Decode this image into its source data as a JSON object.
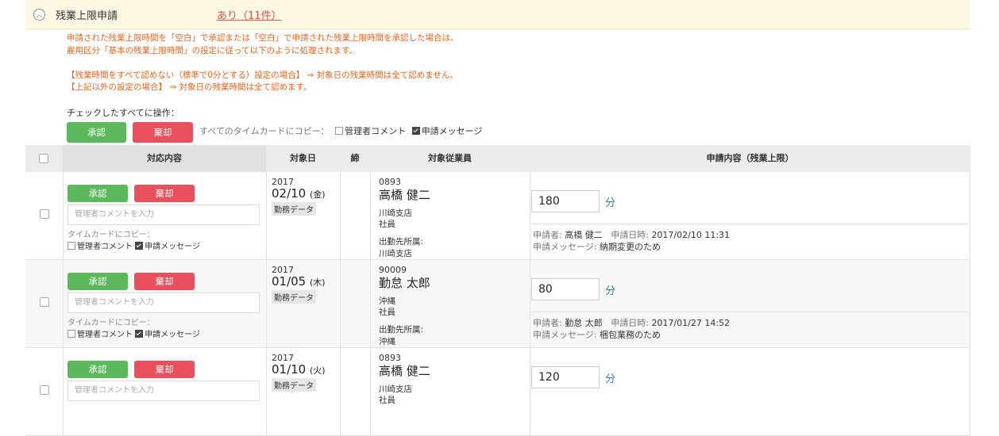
{
  "section": {
    "collapse_icon": "chevron-up-icon",
    "title": "残業上限申請",
    "count_link": "あり（11件）"
  },
  "notice": {
    "line1": "申請された残業上限時間を「空白」で承認または「空白」で申請された残業上限時間を承認した場合は、",
    "line2": "雇用区分「基本の残業上限時間」の設定に従って以下のように処理されます。",
    "line3": "【残業時間をすべて認めない（標準で0分とする）設定の場合】 ⇒ 対象日の残業時間は全て認めません。",
    "line4": "【上記以外の設定の場合】 ⇒ 対象日の残業時間は全て認めます。"
  },
  "bulk": {
    "label": "チェックしたすべてに操作：",
    "approve": "承認",
    "reject": "棄却",
    "copy_label": "すべてのタイムカードにコピー：",
    "admin_comment": "管理者コメント",
    "admin_comment_checked": false,
    "request_message": "申請メッセージ",
    "request_message_checked": true
  },
  "table": {
    "headers": {
      "action": "対応内容",
      "date": "対象日",
      "closed": "締",
      "employee": "対象従業員",
      "request": "申請内容（残業上限）"
    },
    "approve_label": "承認",
    "reject_label": "棄却",
    "comment_placeholder": "管理者コメントを入力",
    "copy_label": "タイムカードにコピー：",
    "admin_comment": "管理者コメント",
    "request_message": "申請メッセージ",
    "dispatch_label": "出勤先所属:",
    "unit": "分",
    "requester_label": "申請者:",
    "requested_at_label": "申請日時:",
    "message_label": "申請メッセージ:",
    "rows": [
      {
        "year": "2017",
        "date": "02/10",
        "weekday": "(金)",
        "badge": "勤務データ",
        "emp_id": "0893",
        "emp_name": "高橋 健二",
        "branch": "川崎支店",
        "role": "社員",
        "dispatch": "川崎支店",
        "minutes": "180",
        "requester": "高橋 健二",
        "requested_at": "2017/02/10 11:31",
        "message": "納期変更のため"
      },
      {
        "year": "2017",
        "date": "01/05",
        "weekday": "(木)",
        "badge": "勤務データ",
        "emp_id": "90009",
        "emp_name": "勤怠 太郎",
        "branch": "沖縄",
        "role": "社員",
        "dispatch": "沖縄",
        "minutes": "80",
        "requester": "勤怠 太郎",
        "requested_at": "2017/01/27 14:52",
        "message": "梱包業務のため"
      },
      {
        "year": "2017",
        "date": "01/10",
        "weekday": "(火)",
        "badge": "勤務データ",
        "emp_id": "0893",
        "emp_name": "高橋 健二",
        "branch": "川崎支店",
        "role": "社員",
        "dispatch": "",
        "minutes": "120",
        "requester": "",
        "requested_at": "",
        "message": ""
      }
    ]
  },
  "colors": {
    "approve": "#5cb85c",
    "reject": "#e8505b",
    "notice": "#e8641b",
    "header_bg": "#fcf8e3"
  }
}
